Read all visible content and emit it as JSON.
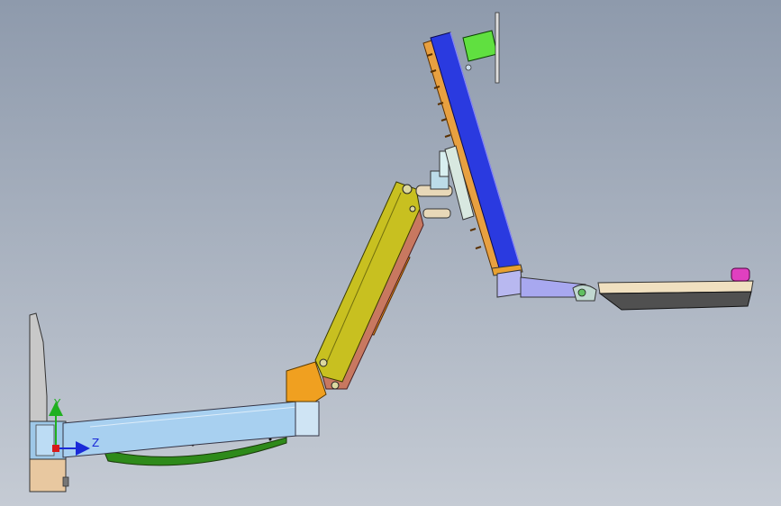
{
  "viewport": {
    "background_top": "#8e9aac",
    "background_bottom": "#c5cbd4"
  },
  "triad": {
    "y_label": "Y",
    "z_label": "Z",
    "y_color": "#20b020",
    "z_color": "#1a2ad8",
    "x_color": "#d81a1a"
  },
  "parts": {
    "wall_plate": "#c8c8c8",
    "wall_bracket": "#e8c8a0",
    "lower_arm": "#a8d0f0",
    "lower_arm_rail": "#2e8a1a",
    "elbow_joint": "#f0a020",
    "upper_arm": "#c8c020",
    "upper_arm_brace": "#c87860",
    "upper_arm_fin": "#e89020",
    "tilt_hinge": "#e8d8b8",
    "monitor_back": "#e8a040",
    "monitor_panel": "#2a3ae0",
    "mount_clip": "#60e040",
    "keyboard_arm": "#a8a8f0",
    "keyboard_tray": "#505050",
    "mouse": "#e040c0"
  }
}
